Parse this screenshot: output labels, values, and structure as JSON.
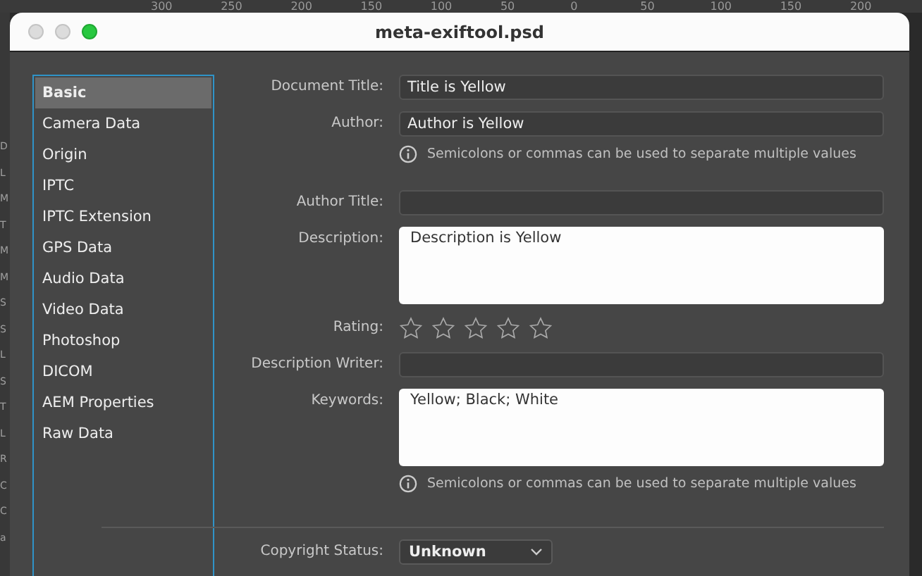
{
  "ruler": {
    "labels": [
      "300",
      "250",
      "200",
      "150",
      "100",
      "50",
      "0",
      "50",
      "100",
      "150",
      "200"
    ]
  },
  "side_letters": [
    "D",
    "L",
    "M",
    "T",
    "M",
    "M",
    "S",
    "S",
    "L",
    "S",
    "T",
    "L",
    "R",
    "C",
    "C",
    "a"
  ],
  "window": {
    "title": "meta-exiftool.psd"
  },
  "sidebar": {
    "items": [
      {
        "label": "Basic",
        "selected": true
      },
      {
        "label": "Camera Data",
        "selected": false
      },
      {
        "label": "Origin",
        "selected": false
      },
      {
        "label": "IPTC",
        "selected": false
      },
      {
        "label": "IPTC Extension",
        "selected": false
      },
      {
        "label": "GPS Data",
        "selected": false
      },
      {
        "label": "Audio Data",
        "selected": false
      },
      {
        "label": "Video Data",
        "selected": false
      },
      {
        "label": "Photoshop",
        "selected": false
      },
      {
        "label": "DICOM",
        "selected": false
      },
      {
        "label": "AEM Properties",
        "selected": false
      },
      {
        "label": "Raw Data",
        "selected": false
      }
    ]
  },
  "fields": [
    {
      "kind": "text",
      "label": "Document Title:",
      "value": "Title is Yellow"
    },
    {
      "kind": "text",
      "label": "Author:",
      "value": "Author is Yellow",
      "hint": "Semicolons or commas can be used to separate multiple values"
    },
    {
      "kind": "text",
      "label": "Author Title:"
    },
    {
      "kind": "textarea",
      "label": "Description:",
      "value": "Description is Yellow"
    },
    {
      "kind": "rating",
      "label": "Rating:",
      "stars": 0
    },
    {
      "kind": "text",
      "label": "Description Writer:"
    },
    {
      "kind": "textarea",
      "label": "Keywords:",
      "value": "Yellow; Black; White",
      "hint": "Semicolons or commas can be used to separate multiple values"
    }
  ],
  "copyright": {
    "label": "Copyright Status:",
    "value": "Unknown"
  }
}
